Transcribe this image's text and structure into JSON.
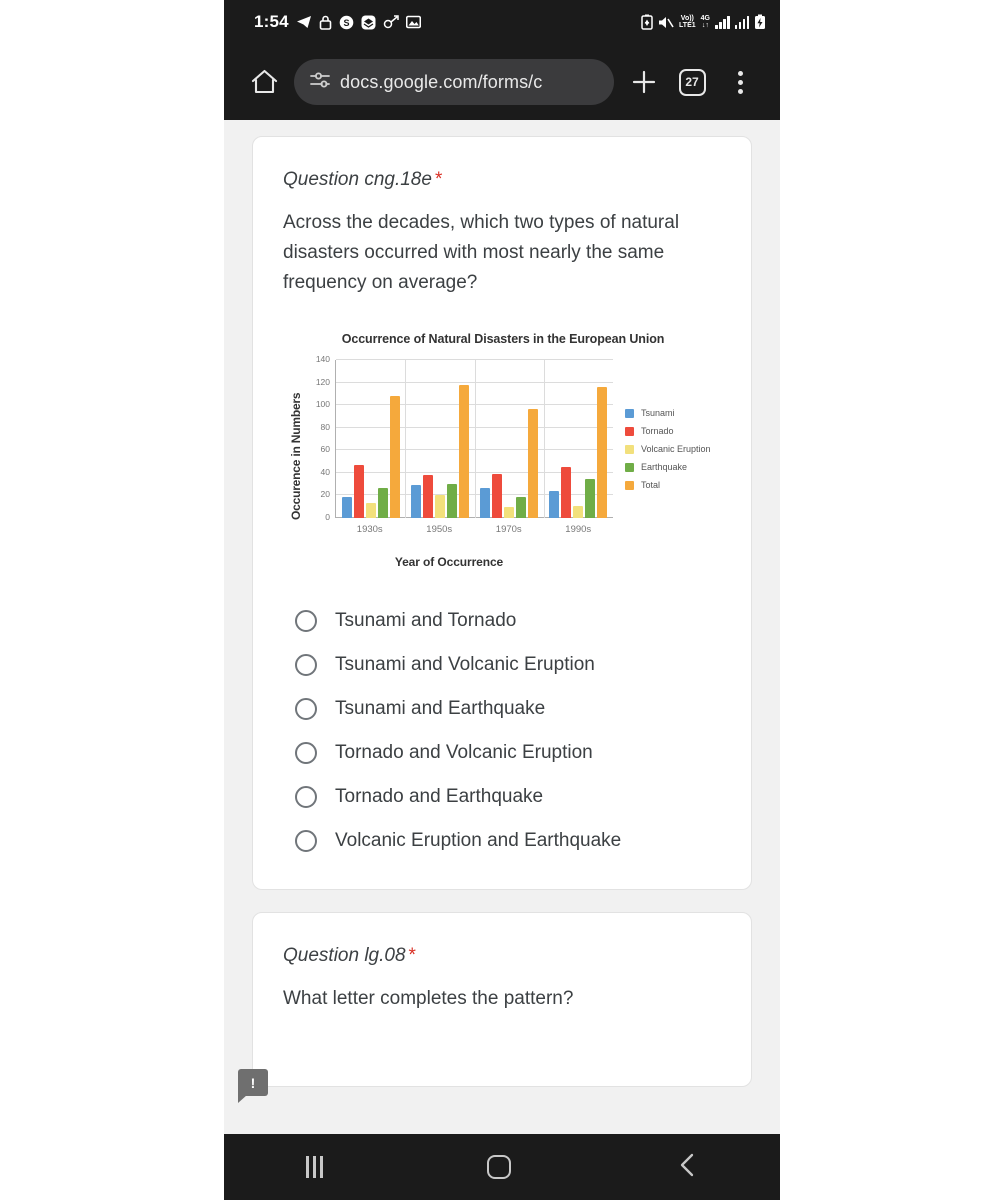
{
  "status_bar": {
    "time": "1:54",
    "left_icons": [
      "telegram-icon",
      "lock-icon",
      "app-s-icon",
      "app-layers-icon",
      "app-satellite-icon",
      "photo-icon"
    ],
    "right_icons": [
      "battery-saver-icon",
      "mute-icon",
      "signal-bars-icon",
      "signal-bars-2-icon",
      "battery-charging-icon"
    ],
    "volte_label": "Vo))",
    "volte_sub": "LTE1",
    "network_label": "4G",
    "data_arrows": "↓↑"
  },
  "browser": {
    "home_icon": "home-icon",
    "page_info_icon": "page-info-icon",
    "url": "docs.google.com/forms/c",
    "new_tab_icon": "plus-icon",
    "tab_count": "27",
    "menu_icon": "kebab-menu-icon"
  },
  "question_1": {
    "title": "Question cng.18e",
    "required_marker": "*",
    "body": "Across the decades, which two types of natural disasters occurred with most nearly the same frequency on average?",
    "options": [
      "Tsunami and Tornado",
      "Tsunami and Volcanic Eruption",
      "Tsunami and Earthquake",
      "Tornado and Volcanic Eruption",
      "Tornado and Earthquake",
      "Volcanic Eruption and Earthquake"
    ]
  },
  "question_2": {
    "title": "Question lg.08",
    "required_marker": "*",
    "body": "What letter completes the pattern?"
  },
  "feedback_tab": {
    "glyph": "!"
  },
  "nav_bar": {
    "recents_icon": "recents-icon",
    "home_icon": "home-circle-icon",
    "back_icon": "back-chevron-icon",
    "back_glyph": "‹"
  },
  "chart_data": {
    "type": "bar",
    "title": "Occurrence of Natural Disasters in the European Union",
    "xlabel": "Year of Occurrence",
    "ylabel": "Occurence in Numbers",
    "categories": [
      "1930s",
      "1950s",
      "1970s",
      "1990s"
    ],
    "ylim": [
      0,
      140
    ],
    "yticks": [
      0,
      20,
      40,
      60,
      80,
      100,
      120,
      140
    ],
    "grid": true,
    "legend_position": "right",
    "series": [
      {
        "name": "Tsunami",
        "color": "#5b9bd5",
        "values": [
          19,
          29,
          27,
          24
        ]
      },
      {
        "name": "Tornado",
        "color": "#ee4b3c",
        "values": [
          47,
          38,
          39,
          45
        ]
      },
      {
        "name": "Volcanic Eruption",
        "color": "#f2e07c",
        "values": [
          13,
          20,
          10,
          11
        ]
      },
      {
        "name": "Earthquake",
        "color": "#70ad47",
        "values": [
          27,
          30,
          19,
          35
        ]
      },
      {
        "name": "Total",
        "color": "#f5a93c",
        "values": [
          108,
          118,
          97,
          116
        ]
      }
    ]
  }
}
